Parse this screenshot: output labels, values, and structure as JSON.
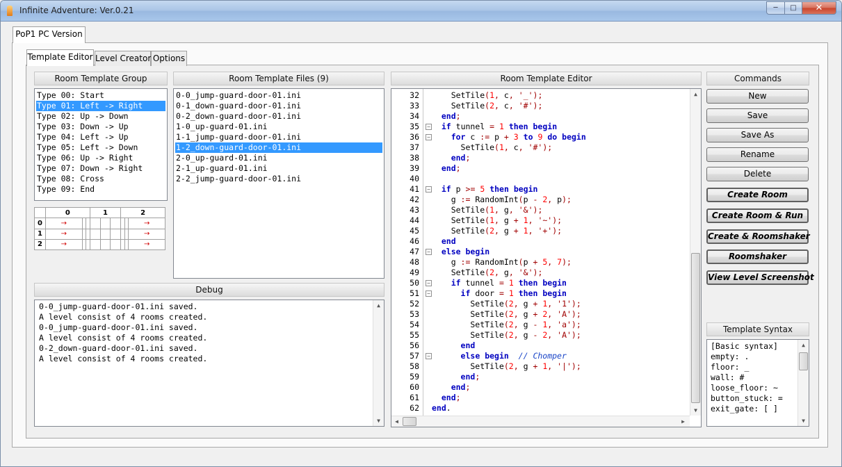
{
  "window": {
    "title": "Infinite Adventure: Ver.0.21",
    "min": "─",
    "max": "□",
    "close": "✕"
  },
  "outer_tab": "PoP1 PC Version",
  "tabs": [
    {
      "label": "Template Editor"
    },
    {
      "label": "Level Creator"
    },
    {
      "label": "Options"
    }
  ],
  "room_group": {
    "header": "Room Template Group",
    "items": [
      "Type 00: Start",
      "Type 01: Left -> Right",
      "Type 02: Up -> Down",
      "Type 03: Down -> Up",
      "Type 04: Left -> Up",
      "Type 05: Left -> Down",
      "Type 06: Up -> Right",
      "Type 07: Down -> Right",
      "Type 08: Cross",
      "Type 09: End"
    ],
    "selected": "Type 01: Left -> Right",
    "grid": {
      "cols": [
        "0",
        "1",
        "2"
      ],
      "rows": [
        "0",
        "1",
        "2"
      ],
      "arrow": "→"
    }
  },
  "template_files": {
    "header": "Room Template Files (9)",
    "items": [
      "0-0_jump-guard-door-01.ini",
      "0-1_down-guard-door-01.ini",
      "0-2_down-guard-door-01.ini",
      "1-0_up-guard-01.ini",
      "1-1_jump-guard-door-01.ini",
      "1-2_down-guard-door-01.ini",
      "2-0_up-guard-01.ini",
      "2-1_up-guard-01.ini",
      "2-2_jump-guard-door-01.ini"
    ],
    "selected": "1-2_down-guard-door-01.ini"
  },
  "debug": {
    "header": "Debug",
    "lines": [
      "0-0_jump-guard-door-01.ini saved.",
      "A level consist of 4 rooms created.",
      "0-0_jump-guard-door-01.ini saved.",
      "A level consist of 4 rooms created.",
      "0-2_down-guard-door-01.ini saved.",
      "A level consist of 4 rooms created."
    ]
  },
  "editor": {
    "header": "Room Template Editor",
    "line_numbers": [
      "32",
      "33",
      "34",
      "35",
      "36",
      "37",
      "38",
      "39",
      "40",
      "41",
      "42",
      "43",
      "44",
      "45",
      "46",
      "47",
      "48",
      "49",
      "50",
      "51",
      "52",
      "53",
      "54",
      "55",
      "56",
      "57",
      "58",
      "59",
      "60",
      "61",
      "62"
    ],
    "lines": [
      "    SetTile(1, c, '_');",
      "    SetTile(2, c, '#');",
      "  end;",
      "  if tunnel = 1 then begin",
      "    for c := p + 3 to 9 do begin",
      "      SetTile(1, c, '#');",
      "    end;",
      "  end;",
      "",
      "  if p >= 5 then begin",
      "    g := RandomInt(p - 2, p);",
      "    SetTile(1, g, '&');",
      "    SetTile(1, g + 1, '~');",
      "    SetTile(2, g + 1, '+');",
      "  end",
      "  else begin",
      "    g := RandomInt(p + 5, 7);",
      "    SetTile(2, g, '&');",
      "    if tunnel = 1 then begin",
      "      if door = 1 then begin",
      "        SetTile(2, g + 1, '1');",
      "        SetTile(2, g + 2, 'A');",
      "        SetTile(2, g - 1, 'a');",
      "        SetTile(2, g - 2, 'A');",
      "      end",
      "      else begin  // Chomper",
      "        SetTile(2, g + 1, '|');",
      "      end;",
      "    end;",
      "  end;",
      "end."
    ]
  },
  "commands": {
    "header": "Commands",
    "buttons": [
      "New",
      "Save",
      "Save As",
      "Rename",
      "Delete"
    ],
    "bold_buttons": [
      "Create Room",
      "Create Room & Run",
      "Create & Roomshaker",
      "Roomshaker",
      "View Level Screenshot"
    ]
  },
  "syntax": {
    "header": "Template Syntax",
    "lines": [
      "[Basic syntax]",
      "empty: .",
      "floor: _",
      "wall: #",
      "loose_floor: ~",
      "button_stuck: =",
      "exit_gate: [ ]"
    ]
  }
}
